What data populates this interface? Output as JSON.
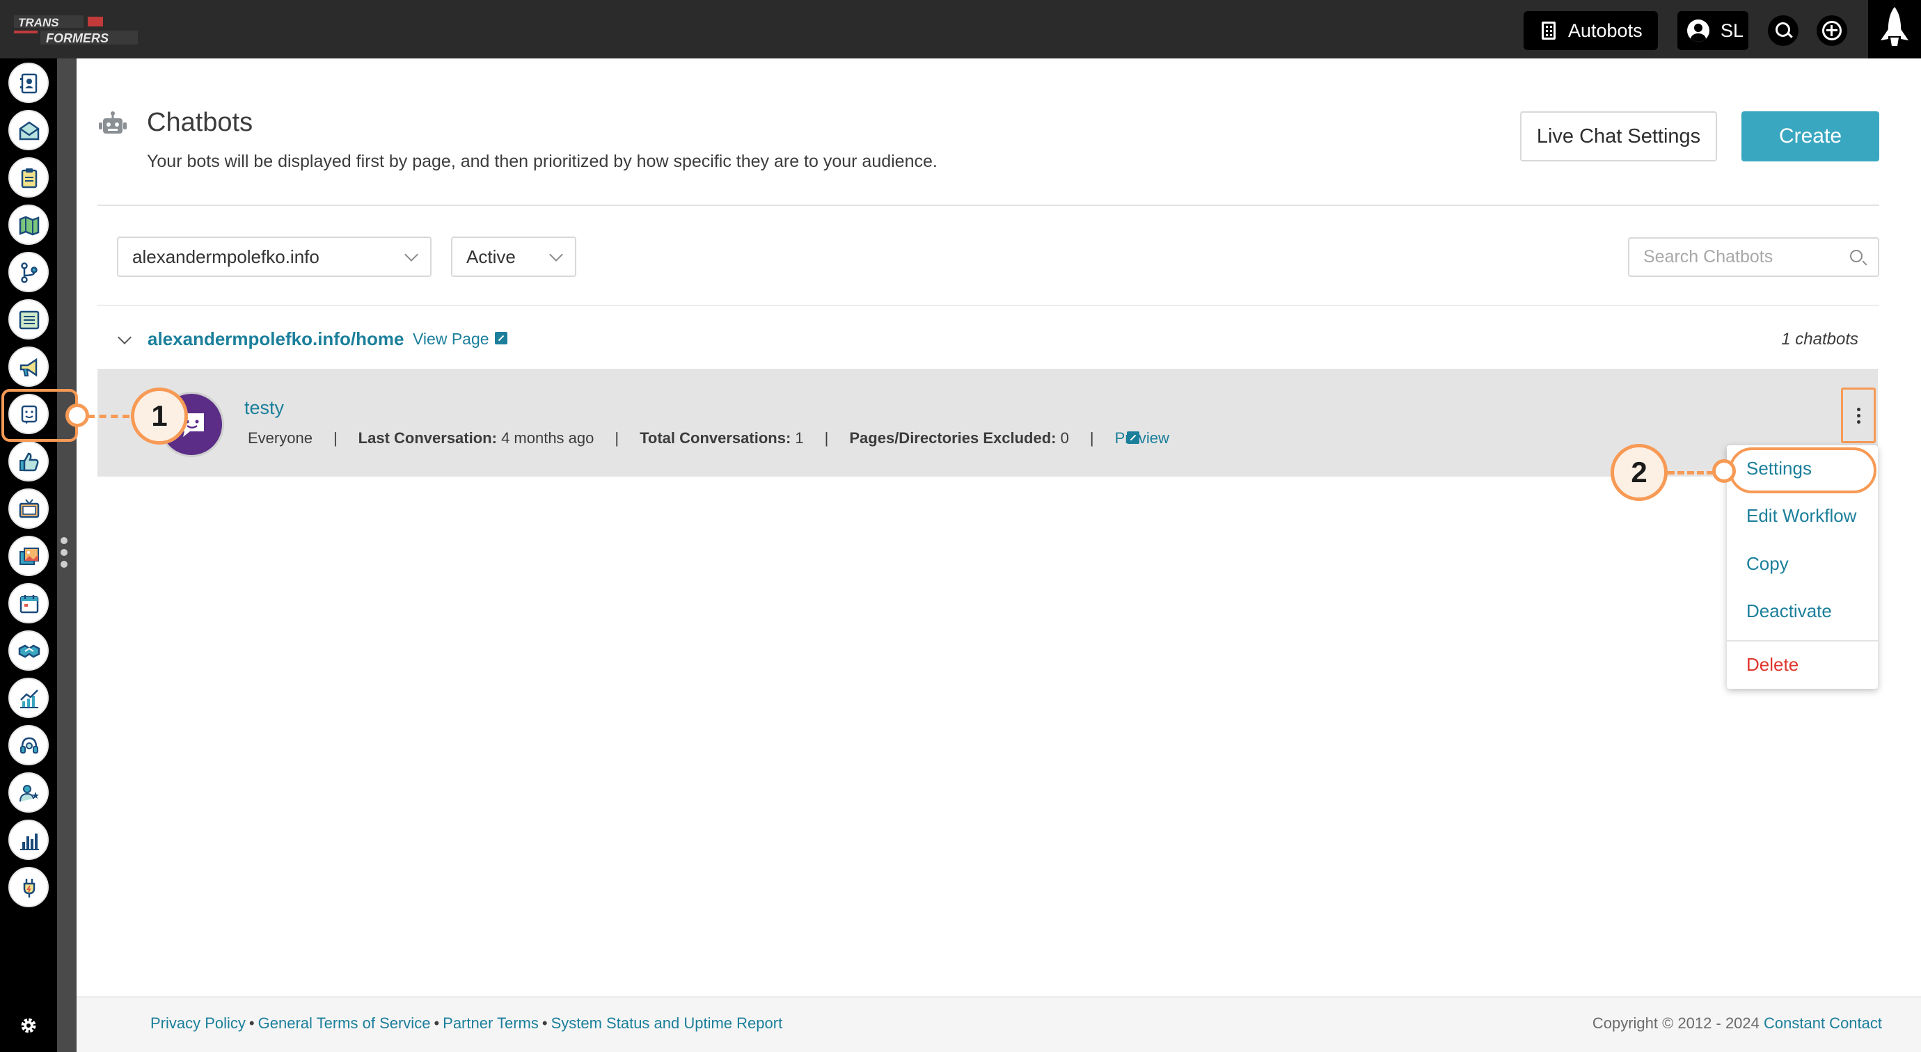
{
  "topbar": {
    "logo_text": "TRANSFORMERS",
    "account_label": "Autobots",
    "user_initials": "SL"
  },
  "sidebar": {
    "items": [
      {
        "name": "contacts",
        "icon": "contact-book-icon"
      },
      {
        "name": "email",
        "icon": "email-open-icon"
      },
      {
        "name": "forms",
        "icon": "clipboard-icon"
      },
      {
        "name": "maps",
        "icon": "map-icon"
      },
      {
        "name": "automation",
        "icon": "branch-icon"
      },
      {
        "name": "lists",
        "icon": "list-icon"
      },
      {
        "name": "campaigns",
        "icon": "megaphone-icon"
      },
      {
        "name": "chatbots",
        "icon": "chatbot-icon"
      },
      {
        "name": "social",
        "icon": "thumbs-up-icon"
      },
      {
        "name": "video",
        "icon": "tv-icon"
      },
      {
        "name": "media",
        "icon": "images-icon"
      },
      {
        "name": "events",
        "icon": "calendar-icon"
      },
      {
        "name": "deals",
        "icon": "handshake-icon"
      },
      {
        "name": "reports",
        "icon": "trend-chart-icon"
      },
      {
        "name": "support",
        "icon": "headset-icon"
      },
      {
        "name": "audience",
        "icon": "user-star-icon"
      },
      {
        "name": "analytics",
        "icon": "bar-chart-icon"
      },
      {
        "name": "integrations",
        "icon": "plug-icon"
      }
    ]
  },
  "page": {
    "title": "Chatbots",
    "subtitle": "Your bots will be displayed first by page, and then prioritized by how specific they are to your audience.",
    "live_chat_settings_label": "Live Chat Settings",
    "create_label": "Create"
  },
  "filters": {
    "domain_value": "alexandermpolefko.info",
    "status_value": "Active",
    "search_placeholder": "Search Chatbots"
  },
  "group": {
    "title": "alexandermpolefko.info/home",
    "view_page_label": "View Page",
    "count_label": "1 chatbots"
  },
  "bot": {
    "name": "testy",
    "audience": "Everyone",
    "last_conversation_label": "Last Conversation:",
    "last_conversation_value": "4 months ago",
    "total_conversations_label": "Total Conversations:",
    "total_conversations_value": "1",
    "excluded_label": "Pages/Directories Excluded:",
    "excluded_value": "0",
    "preview_label": "Preview",
    "separator": "|"
  },
  "menu": {
    "items": [
      "Settings",
      "Edit Workflow",
      "Copy",
      "Deactivate",
      "Delete"
    ]
  },
  "callouts": {
    "first": "1",
    "second": "2"
  },
  "footer": {
    "links": [
      "Privacy Policy",
      "General Terms of Service",
      "Partner Terms",
      "System Status and Uptime Report"
    ],
    "bullet": "•",
    "copyright": "Copyright © 2012 - 2024",
    "company": "Constant Contact"
  },
  "colors": {
    "accent": "#3aa7c1",
    "link": "#1b7f9b",
    "highlight": "#f79a55",
    "danger": "#e0352b",
    "avatar": "#5b2d87"
  }
}
